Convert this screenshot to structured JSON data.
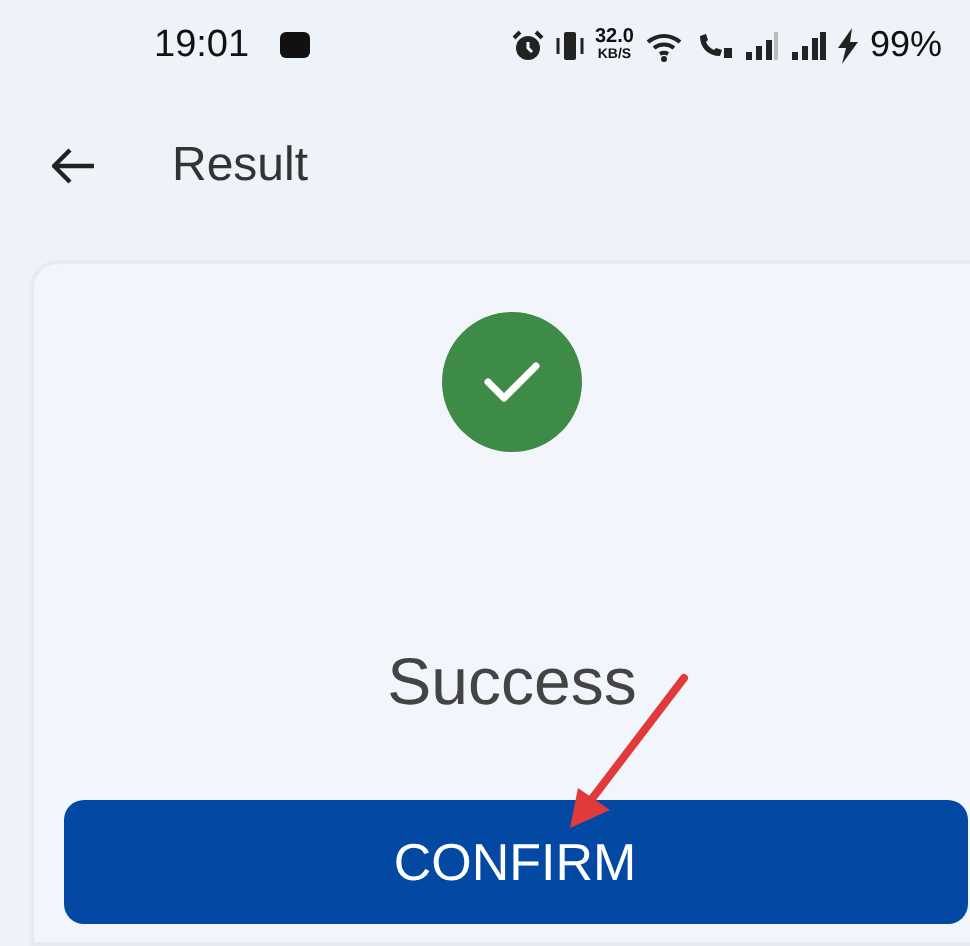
{
  "status_bar": {
    "time": "19:01",
    "speed_value": "32.0",
    "speed_unit": "KB/S",
    "battery": "99%"
  },
  "header": {
    "title": "Result"
  },
  "result": {
    "message": "Success"
  },
  "confirm_button": {
    "label": "CONFIRM"
  }
}
